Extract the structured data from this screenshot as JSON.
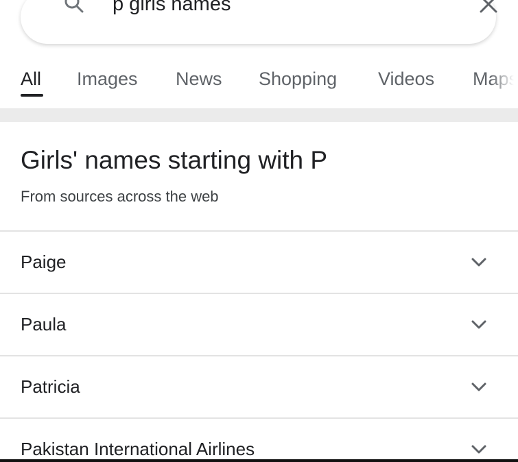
{
  "search": {
    "query": "p girls names",
    "icon": "search-icon",
    "clear_icon": "close-icon"
  },
  "tabs": [
    {
      "label": "All",
      "active": true
    },
    {
      "label": "Images",
      "active": false
    },
    {
      "label": "News",
      "active": false
    },
    {
      "label": "Shopping",
      "active": false
    },
    {
      "label": "Videos",
      "active": false
    },
    {
      "label": "Maps",
      "active": false
    }
  ],
  "panel": {
    "title": "Girls' names starting with P",
    "subtitle": "From sources across the web",
    "items": [
      {
        "label": "Paige",
        "icon": "chevron-down-icon"
      },
      {
        "label": "Paula",
        "icon": "chevron-down-icon"
      },
      {
        "label": "Patricia",
        "icon": "chevron-down-icon"
      },
      {
        "label": "Pakistan International Airlines",
        "icon": "chevron-down-icon"
      }
    ]
  },
  "colors": {
    "text": "#202124",
    "muted": "#5f6368",
    "divider": "#e3e3e3",
    "separator": "#ebebeb"
  }
}
